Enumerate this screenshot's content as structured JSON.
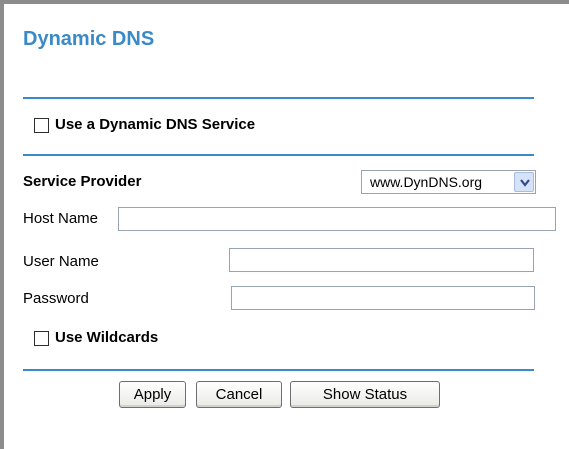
{
  "title": "Dynamic DNS",
  "use_ddns": {
    "label": "Use a Dynamic DNS Service",
    "checked": false
  },
  "service_provider": {
    "label": "Service Provider",
    "selected": "www.DynDNS.org"
  },
  "host_name": {
    "label": "Host Name",
    "value": ""
  },
  "user_name": {
    "label": "User Name",
    "value": ""
  },
  "password": {
    "label": "Password",
    "value": ""
  },
  "use_wildcards": {
    "label": "Use Wildcards",
    "checked": false
  },
  "buttons": {
    "apply": "Apply",
    "cancel": "Cancel",
    "show_status": "Show Status"
  },
  "colors": {
    "accent": "#3a8ac8",
    "frame": "#8c8c8c"
  },
  "icons": {
    "select_arrow": "chevron-down-icon"
  }
}
